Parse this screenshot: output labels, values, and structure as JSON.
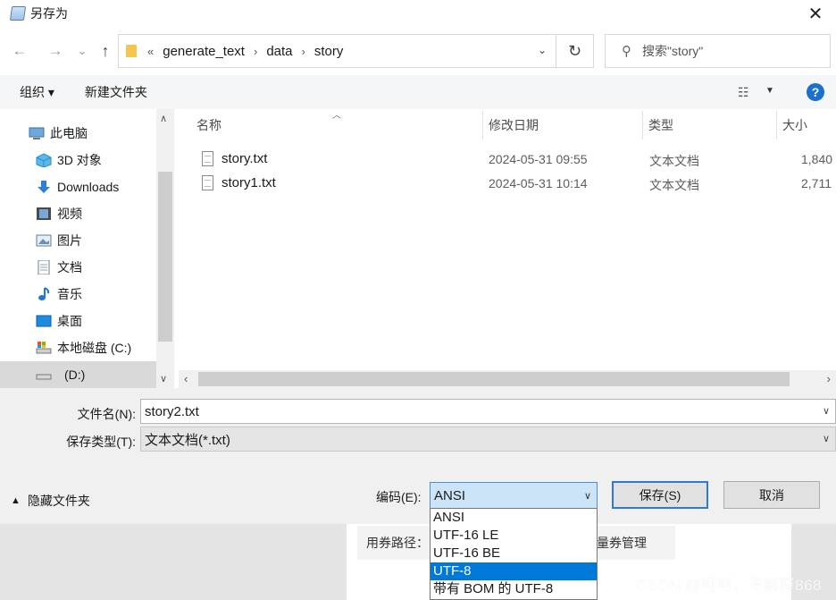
{
  "dialog": {
    "title": "另存为",
    "close": "✕"
  },
  "nav": {
    "back": "←",
    "forward": "→",
    "history": "⌄",
    "up": "↑",
    "breadcrumb_prefix": "«",
    "breadcrumbs": [
      "generate_text",
      "data",
      "story"
    ],
    "separator": "›",
    "search_placeholder": "搜索\"story\""
  },
  "toolbar": {
    "organize": "组织 ▾",
    "new_folder": "新建文件夹",
    "help": "?"
  },
  "sidebar": {
    "items": [
      {
        "label": "此电脑",
        "icon": "computer-icon"
      },
      {
        "label": "3D 对象",
        "icon": "cube-icon"
      },
      {
        "label": "Downloads",
        "icon": "download-arrow-icon"
      },
      {
        "label": "视频",
        "icon": "video-icon"
      },
      {
        "label": "图片",
        "icon": "picture-icon"
      },
      {
        "label": "文档",
        "icon": "document-icon"
      },
      {
        "label": "音乐",
        "icon": "music-note-icon"
      },
      {
        "label": "桌面",
        "icon": "desktop-icon"
      },
      {
        "label": "本地磁盘 (C:)",
        "icon": "drive-c-icon"
      },
      {
        "label": "(D:)",
        "icon": "drive-d-icon"
      }
    ]
  },
  "files": {
    "columns": [
      "名称",
      "修改日期",
      "类型",
      "大小"
    ],
    "rows": [
      {
        "name": "story.txt",
        "date": "2024-05-31 09:55",
        "type": "文本文档",
        "size": "1,840"
      },
      {
        "name": "story1.txt",
        "date": "2024-05-31 10:14",
        "type": "文本文档",
        "size": "2,711"
      }
    ]
  },
  "form": {
    "filename_label": "文件名(N):",
    "filename_value": "story2.txt",
    "filetype_label": "保存类型(T):",
    "filetype_value": "文本文档(*.txt)",
    "hide_folders": "隐藏文件夹",
    "encoding_label": "编码(E):",
    "encoding_value": "ANSI",
    "save_button": "保存(S)",
    "cancel_button": "取消",
    "encoding_options": [
      "ANSI",
      "UTF-16 LE",
      "UTF-16 BE",
      "UTF-8",
      "带有 BOM 的 UTF-8"
    ],
    "encoding_highlighted": "UTF-8"
  },
  "background": {
    "coupon_path_label": "用券路径：",
    "coupon_manage": "量券管理",
    "watermark": "CSDN @呵呵，不解释868"
  }
}
